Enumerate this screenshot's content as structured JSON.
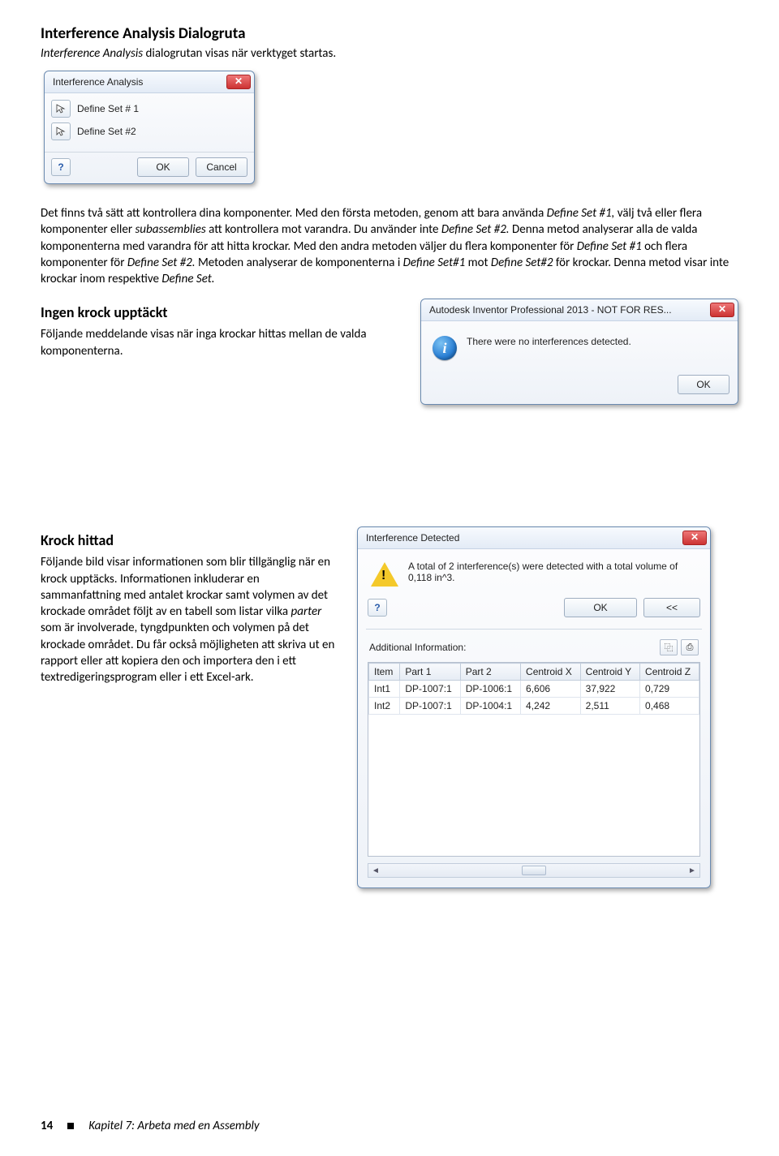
{
  "doc": {
    "title": "Interference Analysis Dialogruta",
    "subtitle_a": "Interference Analysis",
    "subtitle_b": " dialogrutan visas när verktyget startas.",
    "para_a": "Det finns två sätt att kontrollera dina komponenter. Med den första metoden, genom att bara använda ",
    "para_b_em": "Define Set #1,",
    "para_c": " välj två eller flera komponenter eller ",
    "para_c_em": "subassemblies",
    "para_d": " att kontrollera mot varandra. Du använder inte ",
    "para_d_em": "Define Set #2.",
    "para_e": " Denna metod analyserar alla de valda komponenterna med varandra för att hitta krockar. Med den andra metoden väljer du flera komponenter för ",
    "para_e_em": "Define Set #1",
    "para_f": " och flera komponenter för ",
    "para_f_em": "Define Set #2.",
    "para_g": " Metoden analyserar de komponenterna i ",
    "para_g_em": "Define Set#1",
    "para_h": " mot ",
    "para_h_em": "Define Set#2",
    "para_i": " för krockar. Denna metod visar inte krockar inom respektive ",
    "para_i_em": "Define Set.",
    "sec1_title": "Ingen krock upptäckt",
    "sec1_body": "Följande meddelande visas när inga krockar hittas mellan de valda komponenterna.",
    "sec2_title": "Krock hittad",
    "sec2_body_a": "Följande bild visar informationen som blir tillgänglig när en krock upptäcks. Informationen inkluderar en sammanfattning med antalet krockar samt volymen av det krockade området följt av en tabell som listar vilka ",
    "sec2_body_em": "parter",
    "sec2_body_b": " som är involverade, tyngdpunkten och volymen på det krockade området. Du får också möjligheten att skriva ut en rapport eller att kopiera den och importera den i ett textredigeringsprogram eller i ett Excel-ark."
  },
  "dlg1": {
    "title": "Interference Analysis",
    "row1": "Define Set # 1",
    "row2": "Define Set #2",
    "help": "?",
    "ok": "OK",
    "cancel": "Cancel",
    "close": "✕"
  },
  "dlg2": {
    "title": "Autodesk Inventor Professional 2013 - NOT FOR RES...",
    "msg": "There were no interferences detected.",
    "ok": "OK",
    "close": "✕"
  },
  "dlg3": {
    "title": "Interference Detected",
    "summary": "A total of 2 interference(s) were detected with a total volume of 0,118 in^3.",
    "help": "?",
    "ok": "OK",
    "back": "<<",
    "addl": "Additional Information:",
    "copy_icon": "⿻",
    "print_icon": "⎙",
    "close": "✕",
    "cols": [
      "Item",
      "Part 1",
      "Part 2",
      "Centroid X",
      "Centroid Y",
      "Centroid Z"
    ],
    "rows": [
      [
        "Int1",
        "DP-1007:1",
        "DP-1006:1",
        "6,606",
        "37,922",
        "0,729"
      ],
      [
        "Int2",
        "DP-1007:1",
        "DP-1004:1",
        "4,242",
        "2,511",
        "0,468"
      ]
    ]
  },
  "footer": {
    "page": "14",
    "chapter": "Kapitel 7: Arbeta med en Assembly"
  }
}
